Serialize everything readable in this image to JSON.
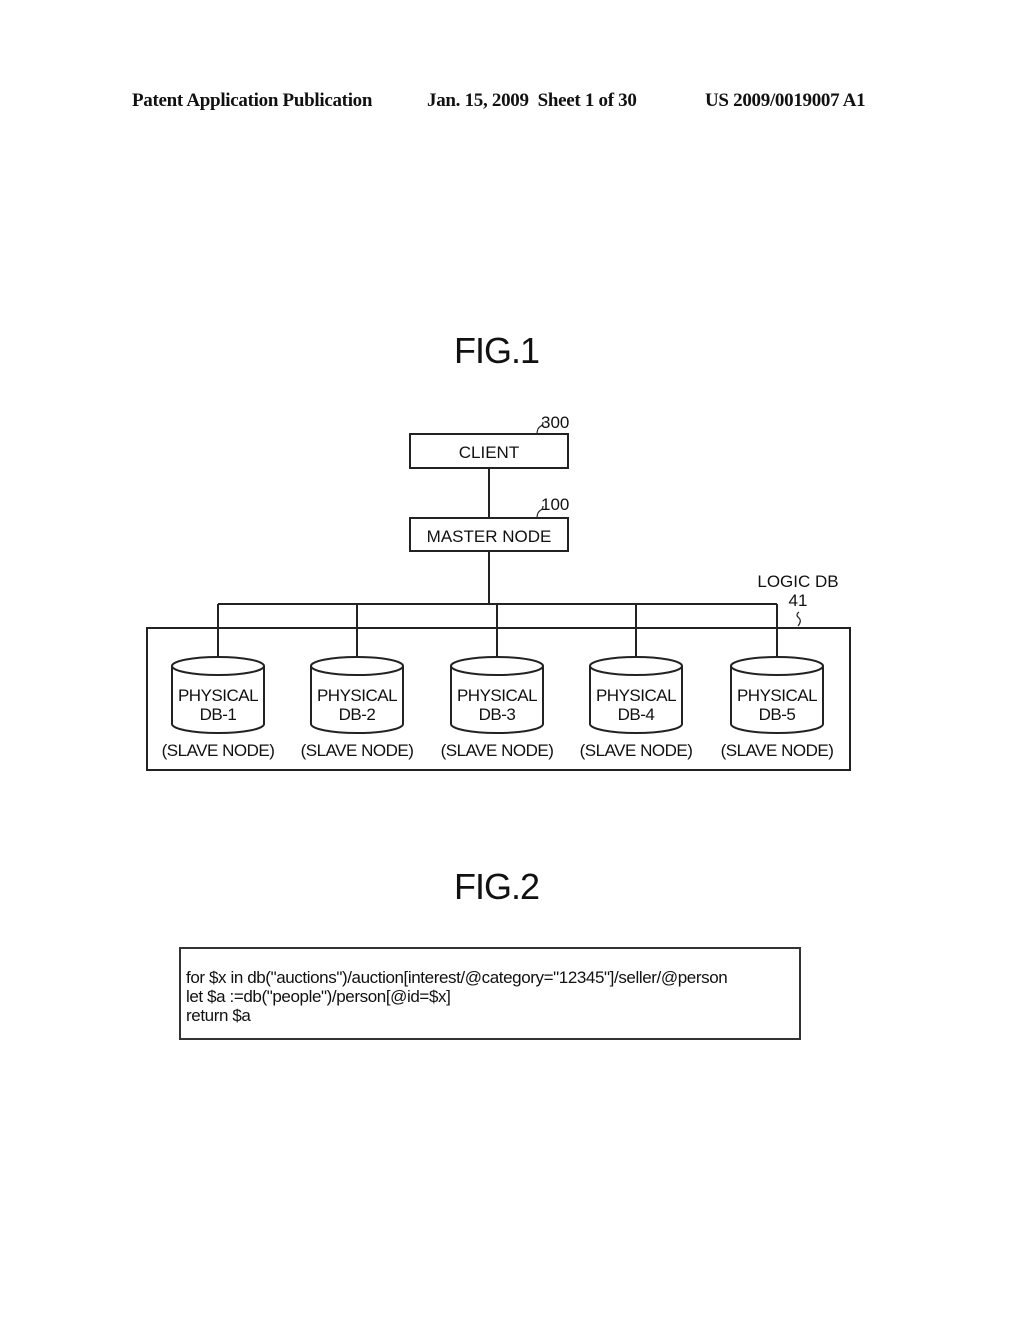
{
  "header": {
    "publication": "Patent Application Publication",
    "date_sheet": "Jan. 15, 2009  Sheet 1 of 30",
    "number": "US 2009/0019007 A1"
  },
  "fig1": {
    "title": "FIG.1",
    "client": {
      "label": "CLIENT",
      "ref": "300"
    },
    "master": {
      "label": "MASTER NODE",
      "ref": "100"
    },
    "logic_db": {
      "label": "LOGIC DB",
      "ref": "41"
    },
    "slaves": [
      {
        "line1": "PHYSICAL",
        "line2": "DB-1",
        "role": "(SLAVE NODE)"
      },
      {
        "line1": "PHYSICAL",
        "line2": "DB-2",
        "role": "(SLAVE NODE)"
      },
      {
        "line1": "PHYSICAL",
        "line2": "DB-3",
        "role": "(SLAVE NODE)"
      },
      {
        "line1": "PHYSICAL",
        "line2": "DB-4",
        "role": "(SLAVE NODE)"
      },
      {
        "line1": "PHYSICAL",
        "line2": "DB-5",
        "role": "(SLAVE NODE)"
      }
    ]
  },
  "fig2": {
    "title": "FIG.2",
    "code_lines": [
      "for $x in db(\"auctions\")/auction[interest/@category=\"12345\"]/seller/@person",
      "let $a :=db(\"people\")/person[@id=$x]",
      "return $a"
    ]
  }
}
